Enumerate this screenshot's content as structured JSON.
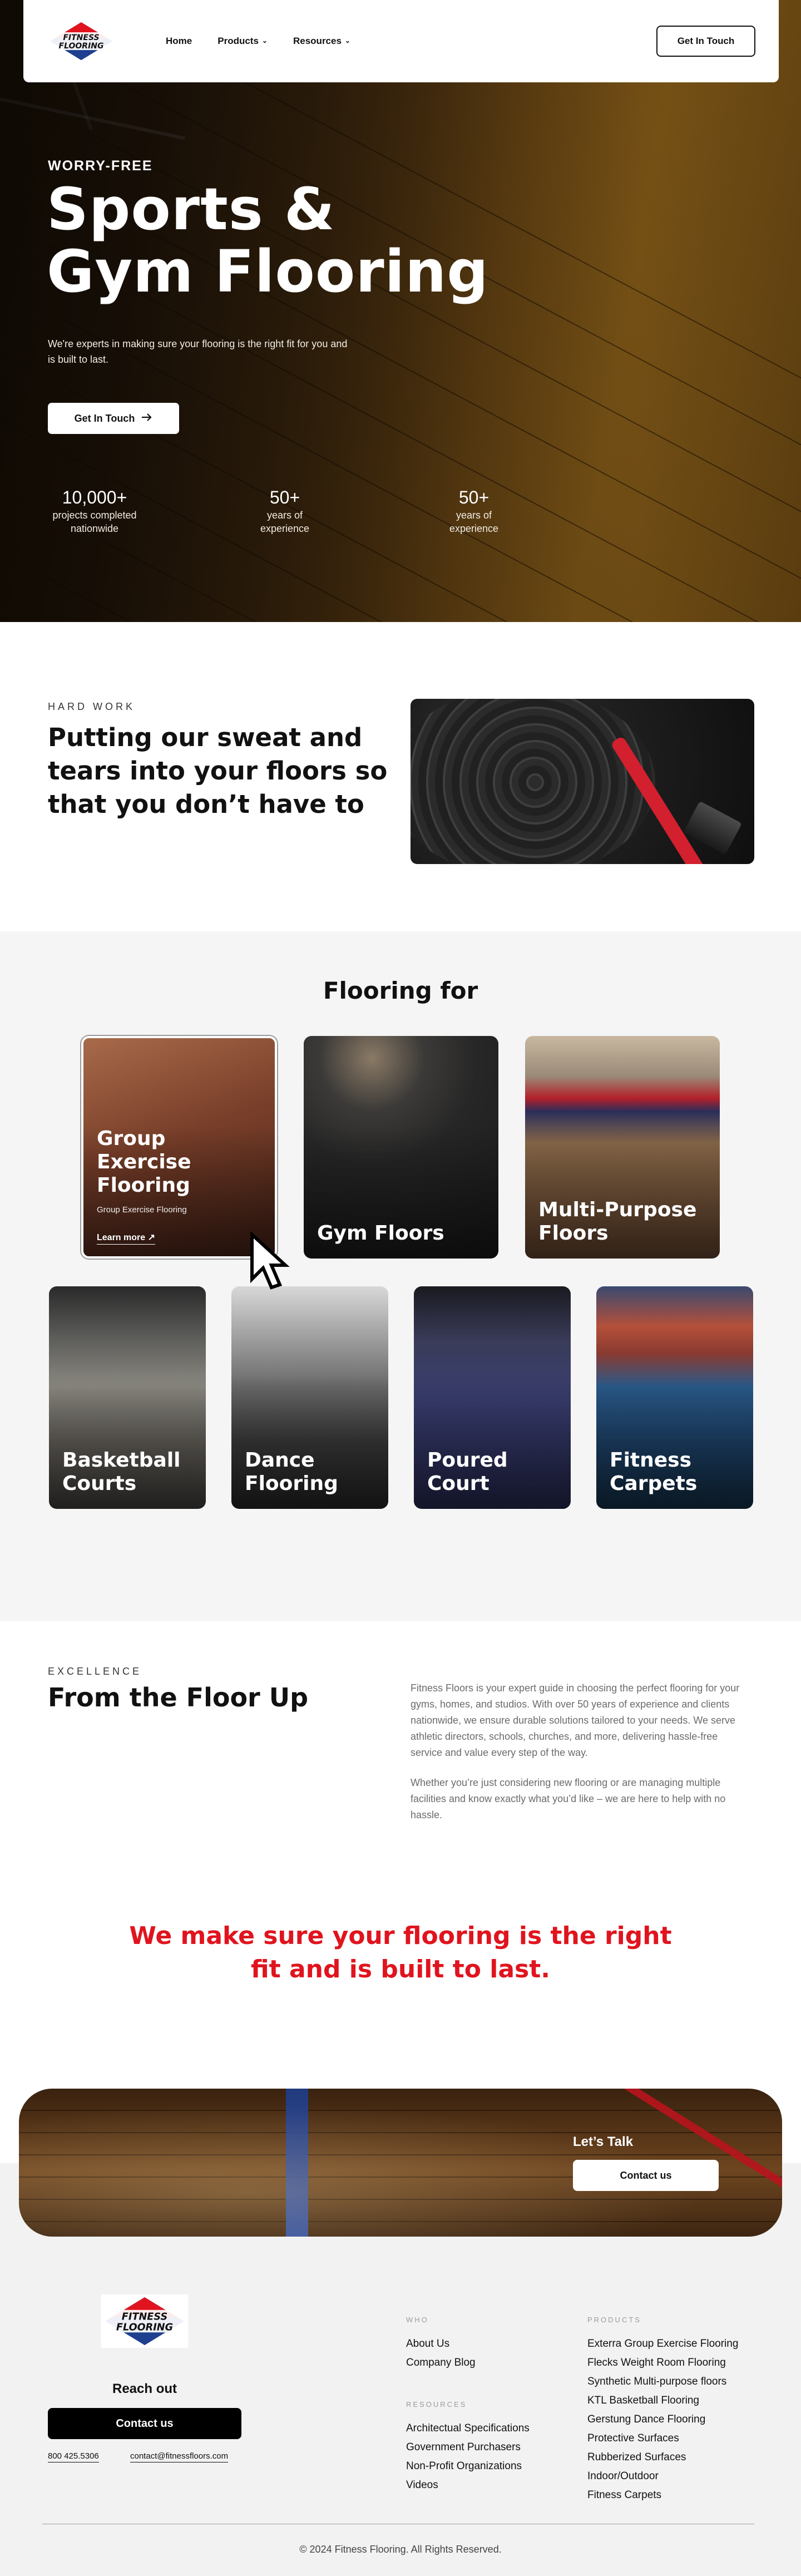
{
  "nav": {
    "logo_text": "FITNESS FLOORING",
    "links": [
      {
        "label": "Home",
        "has_menu": false
      },
      {
        "label": "Products",
        "has_menu": true
      },
      {
        "label": "Resources",
        "has_menu": true
      }
    ],
    "cta_label": "Get In Touch"
  },
  "hero": {
    "eyebrow": "WORRY-FREE",
    "title_line1": "Sports &",
    "title_line2": "Gym Flooring",
    "subtitle": "We're experts in making sure your flooring is the right fit for you and is built to last.",
    "cta_label": "Get In Touch",
    "cta_icon": "arrow-right-icon",
    "stats": [
      {
        "number": "10,000+",
        "label_line1": "projects completed",
        "label_line2": "nationwide"
      },
      {
        "number": "50+",
        "label_line1": "years of",
        "label_line2": "experience"
      },
      {
        "number": "50+",
        "label_line1": "years of",
        "label_line2": "experience"
      }
    ]
  },
  "hard_work": {
    "eyebrow": "HARD WORK",
    "title": "Putting our sweat and tears into your floors so that you don’t have to"
  },
  "flooring_for": {
    "title": "Flooring for",
    "featured": {
      "title_line1": "Group",
      "title_line2": "Exercise",
      "title_line3": "Flooring",
      "subtitle": "Group Exercise Flooring",
      "link_label": "Learn more ↗"
    },
    "cards": [
      {
        "title_line1": "Gym Floors",
        "title_line2": ""
      },
      {
        "title_line1": "Multi-Purpose",
        "title_line2": "Floors"
      },
      {
        "title_line1": "Basketball",
        "title_line2": "Courts"
      },
      {
        "title_line1": "Dance",
        "title_line2": "Flooring"
      },
      {
        "title_line1": "Poured",
        "title_line2": "Court"
      },
      {
        "title_line1": "Fitness",
        "title_line2": "Carpets"
      }
    ]
  },
  "excellence": {
    "eyebrow": "EXCELLENCE",
    "title": "From the Floor Up",
    "para1": "Fitness Floors is your expert guide in choosing the perfect flooring for your gyms, homes, and studios. With over 50 years of experience and clients nationwide, we ensure durable solutions tailored to your needs. We serve athletic directors, schools, churches, and more, delivering hassle-free service and value every step of the way.",
    "para2": "Whether you’re just considering new flooring or are managing multiple facilities and know exactly what you’d like – we are here to help with no hassle."
  },
  "quote": {
    "line1": "We make sure your flooring is the right",
    "line2": "fit and is built to last."
  },
  "talk": {
    "label": "Let’s Talk",
    "button": "Contact us"
  },
  "footer": {
    "logo_text": "FITNESS FLOORING",
    "reach_out": "Reach out",
    "contact_button": "Contact us",
    "phone": "800 425.5306",
    "email": "contact@fitnessfloors.com",
    "who_heading": "WHO",
    "who_links": [
      "About Us",
      "Company Blog"
    ],
    "resources_heading": "RESOURCES",
    "resources_links": [
      "Architectual Specifications",
      "Government Purchasers",
      "Non-Profit Organizations",
      "Videos"
    ],
    "products_heading": "PRODUCTS",
    "products_links": [
      "Exterra Group Exercise Flooring",
      "Flecks Weight Room Flooring",
      "Synthetic Multi-purpose floors",
      "KTL Basketball Flooring",
      "Gerstung Dance Flooring",
      "Protective Surfaces",
      "Rubberized Surfaces",
      "Indoor/Outdoor",
      "Fitness Carpets"
    ],
    "copyright": "© 2024 Fitness Flooring. All Rights Reserved."
  },
  "colors": {
    "accent_red": "#e0141e",
    "logo_blue": "#1f3f8f",
    "dark": "#111111",
    "footer_bg": "#f2f2f2"
  }
}
